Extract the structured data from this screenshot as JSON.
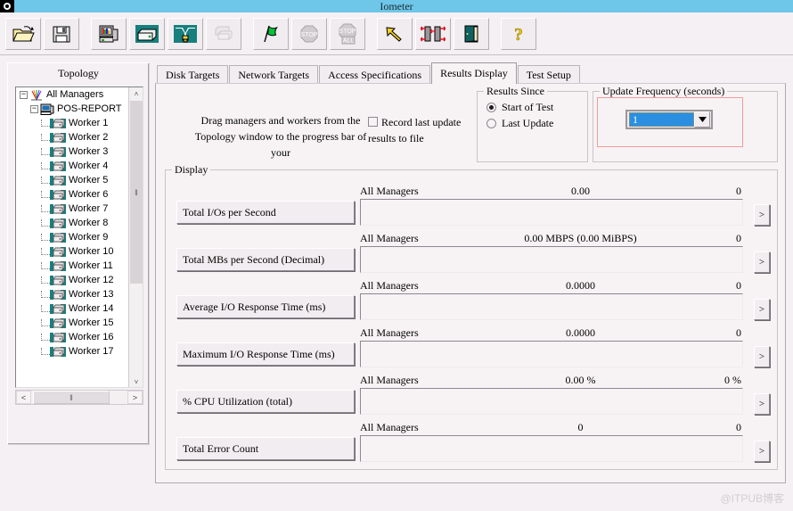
{
  "window": {
    "title": "Iometer",
    "sysicon": "app-icon"
  },
  "toolbar": {
    "buttons": [
      {
        "name": "open-icon",
        "label": "Open"
      },
      {
        "name": "save-icon",
        "label": "Save"
      },
      {
        "name": "new-manager-icon",
        "label": "New Manager"
      },
      {
        "name": "new-worker-icon",
        "label": "New Worker"
      },
      {
        "name": "disconnect-icon",
        "label": "Disconnect"
      },
      {
        "name": "duplicate-worker-icon",
        "label": "Duplicate Worker"
      },
      {
        "name": "start-test-icon",
        "label": "Start Tests"
      },
      {
        "name": "stop-test-icon",
        "label": "Stop Test"
      },
      {
        "name": "stop-all-icon",
        "label": "Stop All Tests"
      },
      {
        "name": "reset-icon",
        "label": "Reset Workers"
      },
      {
        "name": "swap-icon",
        "label": "Swap"
      },
      {
        "name": "exit-icon",
        "label": "Exit"
      },
      {
        "name": "help-icon",
        "label": "Help"
      }
    ]
  },
  "topology": {
    "title": "Topology",
    "root": "All Managers",
    "manager": "POS-REPORT",
    "workers": [
      "Worker 1",
      "Worker 2",
      "Worker 3",
      "Worker 4",
      "Worker 5",
      "Worker 6",
      "Worker 7",
      "Worker 8",
      "Worker 9",
      "Worker 10",
      "Worker 11",
      "Worker 12",
      "Worker 13",
      "Worker 14",
      "Worker 15",
      "Worker 16",
      "Worker 17"
    ],
    "scroll_up": "˄",
    "scroll_down": "˅",
    "scroll_left": "<",
    "scroll_right": ">",
    "grip": "‖"
  },
  "tabs": [
    {
      "label": "Disk Targets",
      "selected": false
    },
    {
      "label": "Network Targets",
      "selected": false
    },
    {
      "label": "Access Specifications",
      "selected": false
    },
    {
      "label": "Results Display",
      "selected": true
    },
    {
      "label": "Test Setup",
      "selected": false
    }
  ],
  "results_display": {
    "drag_hint": "Drag managers and workers from the Topology window to the progress bar of your",
    "record_checkbox": {
      "label": "Record last update results to file",
      "checked": false
    },
    "results_since": {
      "legend": "Results Since",
      "options": [
        {
          "label": "Start of Test",
          "selected": true
        },
        {
          "label": "Last Update",
          "selected": false
        }
      ]
    },
    "update_frequency": {
      "legend": "Update Frequency (seconds)",
      "value": "1",
      "dropdown_arrow": "▼",
      "highlight_color": "#f29b9b"
    },
    "display": {
      "legend": "Display",
      "go_button": ">",
      "rows": [
        {
          "label": "Total I/Os per Second",
          "scope": "All Managers",
          "value": "0.00",
          "right": "0"
        },
        {
          "label": "Total MBs per Second (Decimal)",
          "scope": "All Managers",
          "value": "0.00 MBPS (0.00 MiBPS)",
          "right": "0"
        },
        {
          "label": "Average I/O Response Time (ms)",
          "scope": "All Managers",
          "value": "0.0000",
          "right": "0"
        },
        {
          "label": "Maximum I/O Response Time (ms)",
          "scope": "All Managers",
          "value": "0.0000",
          "right": "0"
        },
        {
          "label": "% CPU Utilization (total)",
          "scope": "All Managers",
          "value": "0.00 %",
          "right": "0 %"
        },
        {
          "label": "Total Error Count",
          "scope": "All Managers",
          "value": "0",
          "right": "0"
        }
      ]
    }
  },
  "watermark": "@ITPUB博客"
}
